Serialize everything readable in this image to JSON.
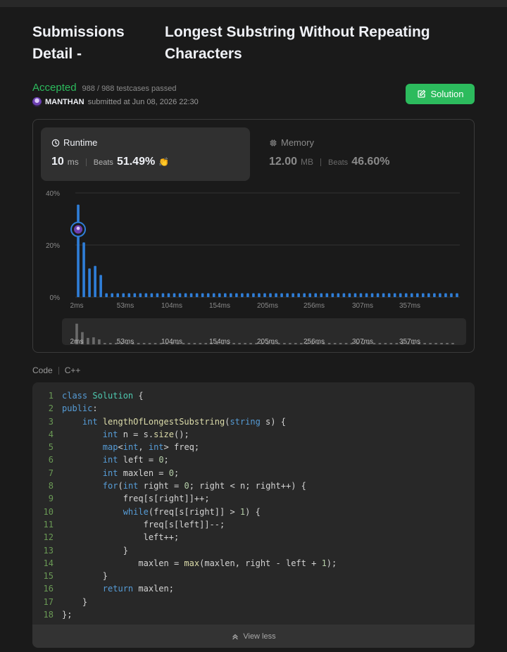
{
  "header": {
    "title_left": "Submissions Detail -",
    "title_right": "Longest Substring Without Repeating Characters"
  },
  "status": {
    "result": "Accepted",
    "testcases": "988 / 988 testcases passed",
    "username": "MANTHAN",
    "submitted_at": "submitted at Jun 08, 2026 22:30",
    "accent_color": "#2cbb5d"
  },
  "solution_button": {
    "label": "Solution",
    "icon": "edit-icon"
  },
  "runtime": {
    "label": "Runtime",
    "icon": "clock-icon",
    "value": "10",
    "unit": "ms",
    "beats_label": "Beats",
    "beats_value": "51.49%",
    "badge_icon": "clap-icon"
  },
  "memory": {
    "label": "Memory",
    "icon": "chip-icon",
    "value": "12.00",
    "unit": "MB",
    "beats_label": "Beats",
    "beats_value": "46.60%"
  },
  "chart_data": {
    "type": "bar",
    "y_ticks": [
      "40%",
      "20%",
      "0%"
    ],
    "ylim": [
      0,
      40
    ],
    "x_tick_labels": [
      "2ms",
      "53ms",
      "104ms",
      "154ms",
      "205ms",
      "256ms",
      "307ms",
      "357ms"
    ],
    "values": [
      35.5,
      21,
      11,
      12,
      8.5,
      1.5,
      1.5,
      1.5,
      1.5,
      1.5,
      1.5,
      1.5,
      1.5,
      1.5,
      1.5,
      1.5,
      1.5,
      1.5,
      1.5,
      1.5,
      1.5,
      1.5,
      1.5,
      1.5,
      1.5,
      1.5,
      1.5,
      1.5,
      1.5,
      1.5,
      1.5,
      1.5,
      1.5,
      1.5,
      1.5,
      1.5,
      1.5,
      1.5,
      1.5,
      1.5,
      1.5,
      1.5,
      1.5,
      1.5,
      1.5,
      1.5,
      1.5,
      1.5,
      1.5,
      1.5,
      1.5,
      1.5,
      1.5,
      1.5,
      1.5,
      1.5,
      1.5,
      1.5,
      1.5,
      1.5,
      1.5,
      1.5,
      1.5,
      1.5,
      1.5,
      1.5,
      1.5,
      1.5
    ],
    "marker_bar_index": 0,
    "marker_value": 26,
    "bar_color": "#2f7ed8",
    "minimap_color": "#6a6a6a"
  },
  "code": {
    "label": "Code",
    "language": "C++",
    "lines": [
      "class Solution {",
      "public:",
      "    int lengthOfLongestSubstring(string s) {",
      "        int n = s.size();",
      "        map<int, int> freq;",
      "        int left = 0;",
      "        int maxlen = 0;",
      "        for(int right = 0; right < n; right++) {",
      "            freq[s[right]]++;",
      "            while(freq[s[right]] > 1) {",
      "                freq[s[left]]--;",
      "                left++;",
      "            }",
      "               maxlen = max(maxlen, right - left + 1);",
      "        }",
      "        return maxlen;",
      "    }",
      "};"
    ],
    "view_less_label": "View less",
    "view_less_icon": "double-chevron-up-icon"
  }
}
